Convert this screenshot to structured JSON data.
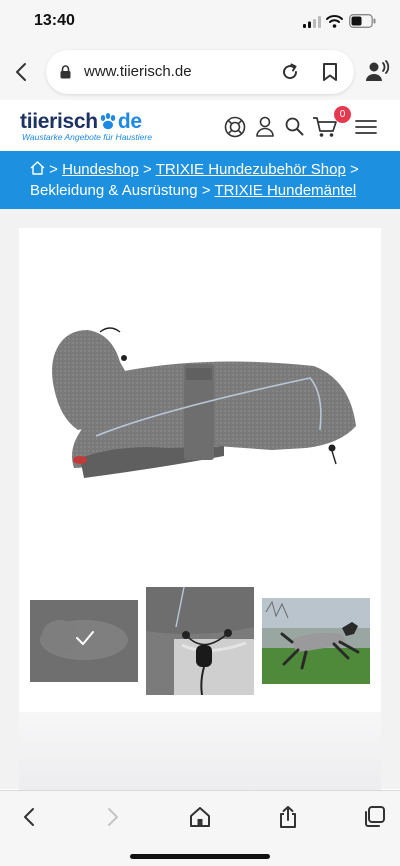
{
  "status_bar": {
    "time": "13:40"
  },
  "browser": {
    "url": "www.tiierisch.de"
  },
  "site": {
    "logo_text_1": "tiierisch",
    "logo_text_2": "de",
    "tagline": "Waustarke Angebote für Haustiere",
    "cart_count": "0"
  },
  "breadcrumb": {
    "sep": ">",
    "items": [
      "Hundeshop",
      "TRIXIE Hundezubehör Shop",
      "Bekleidung & Ausrüstung",
      "TRIXIE Hundemäntel"
    ]
  },
  "colors": {
    "brand_blue": "#1e90e0",
    "logo_navy": "#1b3263",
    "badge_red": "#e53950"
  },
  "icons": {
    "status": [
      "signal-icon",
      "wifi-icon",
      "battery-icon"
    ],
    "browser": [
      "back-chevron-icon",
      "lock-icon",
      "reload-icon",
      "bookmark-icon",
      "voice-person-icon"
    ],
    "header": [
      "lifebuoy-icon",
      "user-icon",
      "search-icon",
      "cart-icon",
      "hamburger-menu-icon"
    ],
    "toolbar": [
      "back-icon",
      "forward-icon",
      "home-icon",
      "share-icon",
      "tabs-icon"
    ]
  }
}
